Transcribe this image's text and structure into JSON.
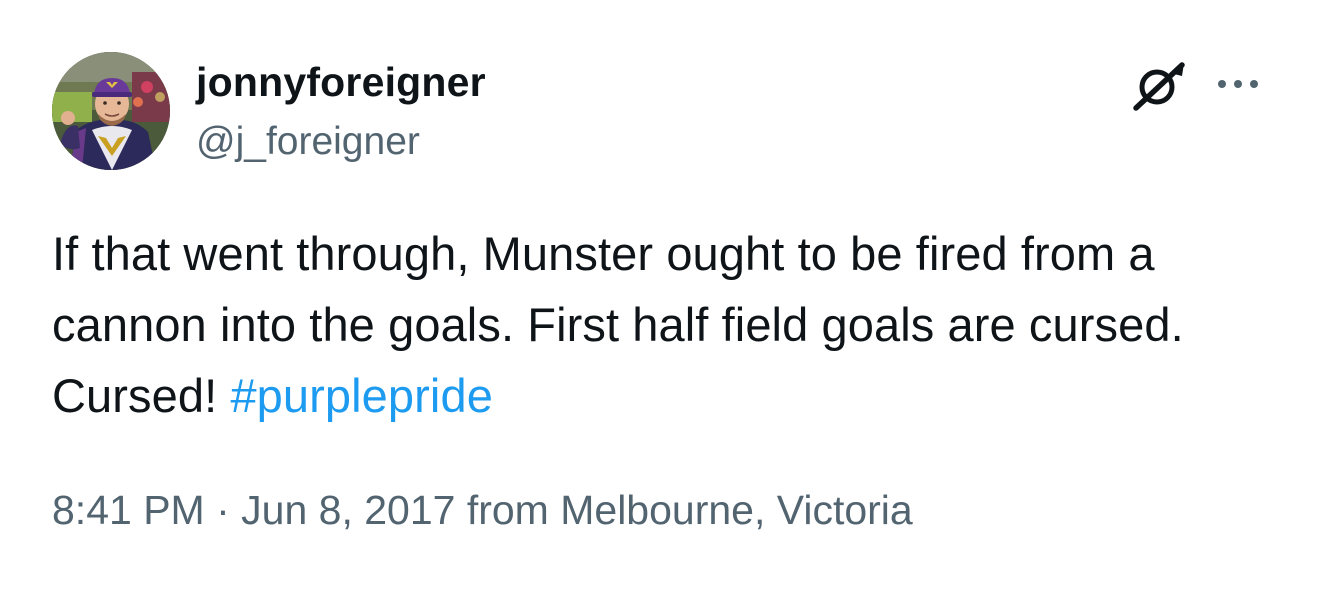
{
  "author": {
    "display_name": "jonnyforeigner",
    "handle": "@j_foreigner"
  },
  "icons": {
    "grok": "grok-slash-icon",
    "more": "more-horizontal-icon",
    "avatar": "profile-photo"
  },
  "tweet": {
    "text_before": "If that went through, Munster ought to be fired from a cannon into the goals. First half field goals are cursed. Cursed! ",
    "hashtag": "#purplepride"
  },
  "meta": {
    "time": "8:41 PM",
    "separator": " · ",
    "date": "Jun 8, 2017",
    "location_prefix": " from ",
    "location": "Melbourne, Victoria"
  },
  "colors": {
    "text": "#0f1419",
    "secondary": "#536471",
    "link": "#1d9bf0",
    "background": "#ffffff"
  }
}
